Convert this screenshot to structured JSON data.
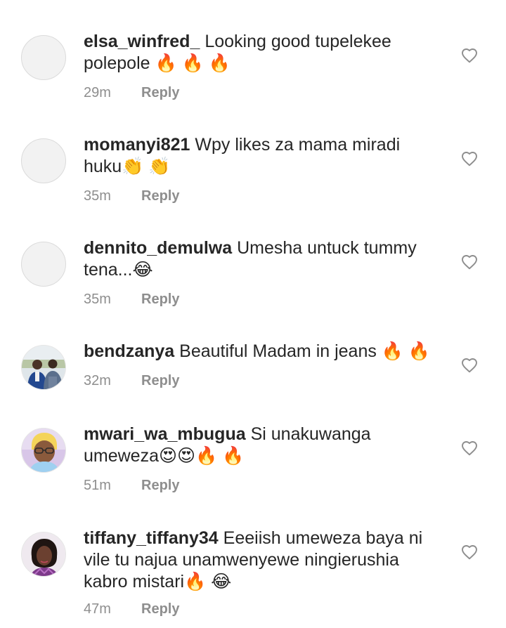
{
  "comments": [
    {
      "username": "elsa_winfred_",
      "text": "Looking good tupelekee polepole 🔥 🔥 🔥",
      "time": "29m",
      "reply_label": "Reply",
      "avatar": "blank-avatar"
    },
    {
      "username": "momanyi821",
      "text": "Wpy likes za mama miradi huku👏 👏",
      "time": "35m",
      "reply_label": "Reply",
      "avatar": "blank-avatar"
    },
    {
      "username": "dennito_demulwa",
      "text": "Umesha untuck tummy tena...😂",
      "time": "35m",
      "reply_label": "Reply",
      "avatar": "blank-avatar"
    },
    {
      "username": "bendzanya",
      "text": "Beautiful Madam in jeans 🔥 🔥",
      "time": "32m",
      "reply_label": "Reply",
      "avatar": "photo-two-people"
    },
    {
      "username": "mwari_wa_mbugua",
      "text": "Si unakuwanga umeweza😍😍🔥 🔥",
      "time": "51m",
      "reply_label": "Reply",
      "avatar": "photo-woman-glasses"
    },
    {
      "username": "tiffany_tiffany34",
      "text": "Eeeiish umeweza baya ni vile tu najua unamwenyewe ningierushia kabro mistari🔥 😂",
      "time": "47m",
      "reply_label": "Reply",
      "avatar": "photo-woman"
    }
  ],
  "icons": {
    "like": "heart-outline-icon"
  },
  "colors": {
    "text": "#262626",
    "secondary": "#8e8e8e",
    "avatar_placeholder": "#f2f2f2"
  }
}
